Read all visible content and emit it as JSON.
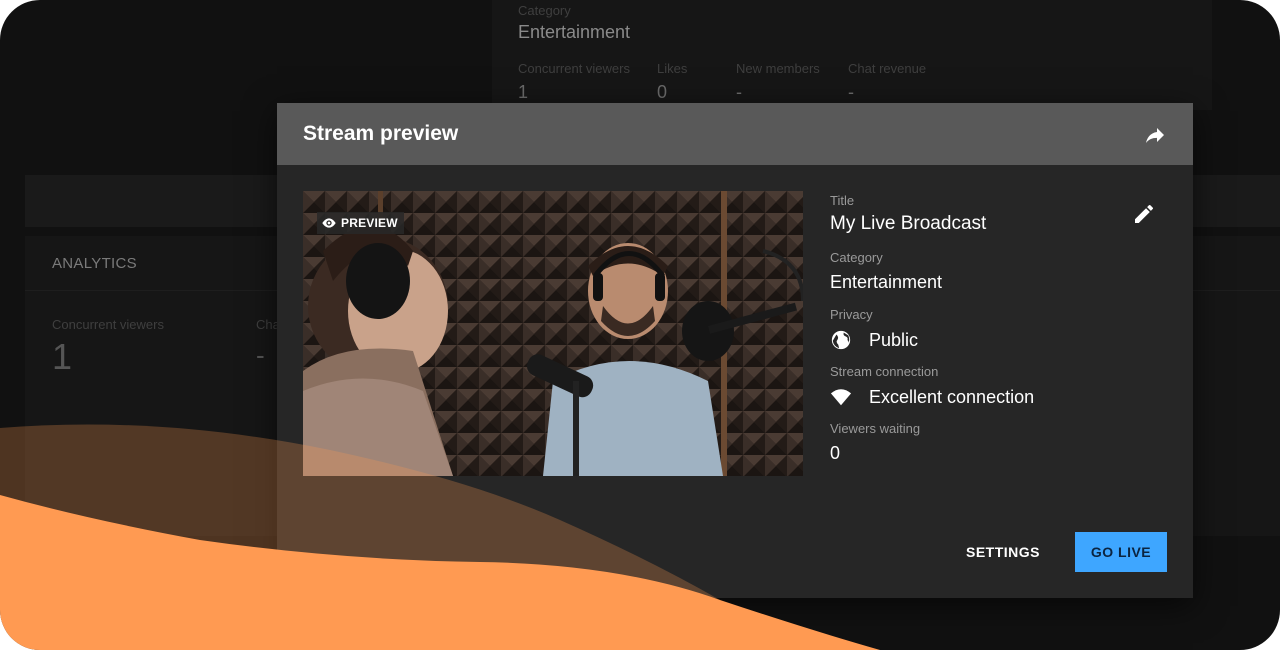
{
  "background": {
    "top_category_label": "Category",
    "top_category_value": "Entertainment",
    "top_stats": [
      {
        "label": "Concurrent viewers",
        "value": "1"
      },
      {
        "label": "Likes",
        "value": "0"
      },
      {
        "label": "New members",
        "value": "-"
      },
      {
        "label": "Chat revenue",
        "value": "-"
      }
    ],
    "analytics_title": "ANALYTICS",
    "analytics_stats": [
      {
        "label": "Concurrent viewers",
        "value": "1"
      },
      {
        "label": "Cha",
        "value": "-"
      }
    ]
  },
  "dialog": {
    "title": "Stream preview",
    "share_icon": "share-icon",
    "preview_badge": "PREVIEW",
    "title_label": "Title",
    "title_value": "My Live Broadcast",
    "edit_icon": "pencil-icon",
    "category_label": "Category",
    "category_value": "Entertainment",
    "privacy_label": "Privacy",
    "privacy_value": "Public",
    "connection_label": "Stream connection",
    "connection_value": "Excellent connection",
    "viewers_label": "Viewers waiting",
    "viewers_value": "0",
    "settings_button": "SETTINGS",
    "golive_button": "GO LIVE"
  },
  "colors": {
    "accent": "#3ea6ff",
    "wave_orange": "#ff9a52",
    "dialog_bg": "#262626",
    "header_bg": "#595959"
  }
}
